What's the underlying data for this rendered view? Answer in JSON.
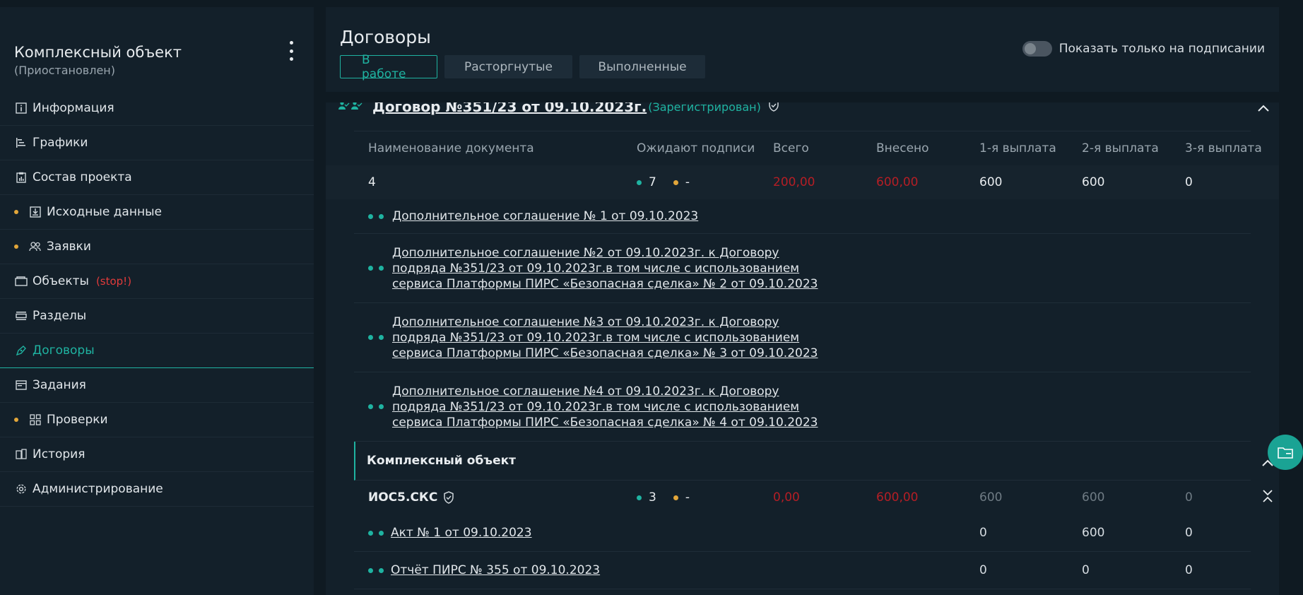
{
  "project": {
    "title": "Комплексный объект",
    "status": "(Приостановлен)"
  },
  "nav": [
    {
      "label": "Информация",
      "icon": "info-icon"
    },
    {
      "label": "Графики",
      "icon": "gantt-icon"
    },
    {
      "label": "Состав проекта",
      "icon": "clipboard-icon"
    },
    {
      "label": "Исходные данные",
      "icon": "download-icon",
      "dot": true
    },
    {
      "label": "Заявки",
      "icon": "users-icon",
      "dot": true
    },
    {
      "label": "Объекты",
      "icon": "wallet-icon",
      "badge": "(stop!)"
    },
    {
      "label": "Разделы",
      "icon": "sections-icon"
    },
    {
      "label": "Договоры",
      "icon": "pen-icon",
      "active": true
    },
    {
      "label": "Задания",
      "icon": "tasks-icon"
    },
    {
      "label": "Проверки",
      "icon": "grid-icon",
      "dot": true
    },
    {
      "label": "История",
      "icon": "history-icon"
    },
    {
      "label": "Администрирование",
      "icon": "gear-icon"
    }
  ],
  "header": {
    "title": "Договоры",
    "tabs": [
      "В работе",
      "Расторгнутые",
      "Выполненные"
    ],
    "toggle_label": "Показать только на подписании"
  },
  "contract": {
    "title": "Договор №351/23 от 09.10.2023г.",
    "status": "(Зарегистрирован)"
  },
  "table": {
    "headers": [
      "Наименование документа",
      "Ожидают подписи",
      "Всего",
      "Внесено",
      "1-я выплата",
      "2-я выплата",
      "3-я выплата"
    ],
    "summary": {
      "name": "4",
      "sig_green": "7",
      "sig_orange": "-",
      "total": "200,00",
      "paid": "600,00",
      "p1": "600",
      "p2": "600",
      "p3": "0"
    },
    "docs": [
      [
        "Дополнительное соглашение № 1 от 09.10.2023"
      ],
      [
        "Дополнительное соглашение №2 от 09.10.2023г. к Договору",
        "подряда №351/23 от 09.10.2023г.в том числе с использованием",
        "сервиса Платформы ПИРС «Безопасная сделка» № 2 от 09.10.2023"
      ],
      [
        "Дополнительное соглашение №3 от 09.10.2023г. к Договору",
        "подряда №351/23 от 09.10.2023г.в том числе с использованием",
        "сервиса Платформы ПИРС «Безопасная сделка» № 3 от 09.10.2023"
      ],
      [
        "Дополнительное соглашение №4 от 09.10.2023г. к Договору",
        "подряда №351/23 от 09.10.2023г.в том числе с использованием",
        "сервиса Платформы ПИРС «Безопасная сделка» № 4 от 09.10.2023"
      ]
    ],
    "section": "Комплексный объект",
    "sub": {
      "name": "ИОС5.СКС",
      "sig_green": "3",
      "sig_orange": "-",
      "total": "0,00",
      "paid": "600,00",
      "p1": "600",
      "p2": "600",
      "p3": "0"
    },
    "sub_docs": [
      {
        "name": "Акт № 1 от 09.10.2023",
        "p1": "0",
        "p2": "600",
        "p3": "0"
      },
      {
        "name": "Отчёт ПИРС № 355 от 09.10.2023",
        "p1": "0",
        "p2": "0",
        "p3": "0"
      }
    ]
  }
}
